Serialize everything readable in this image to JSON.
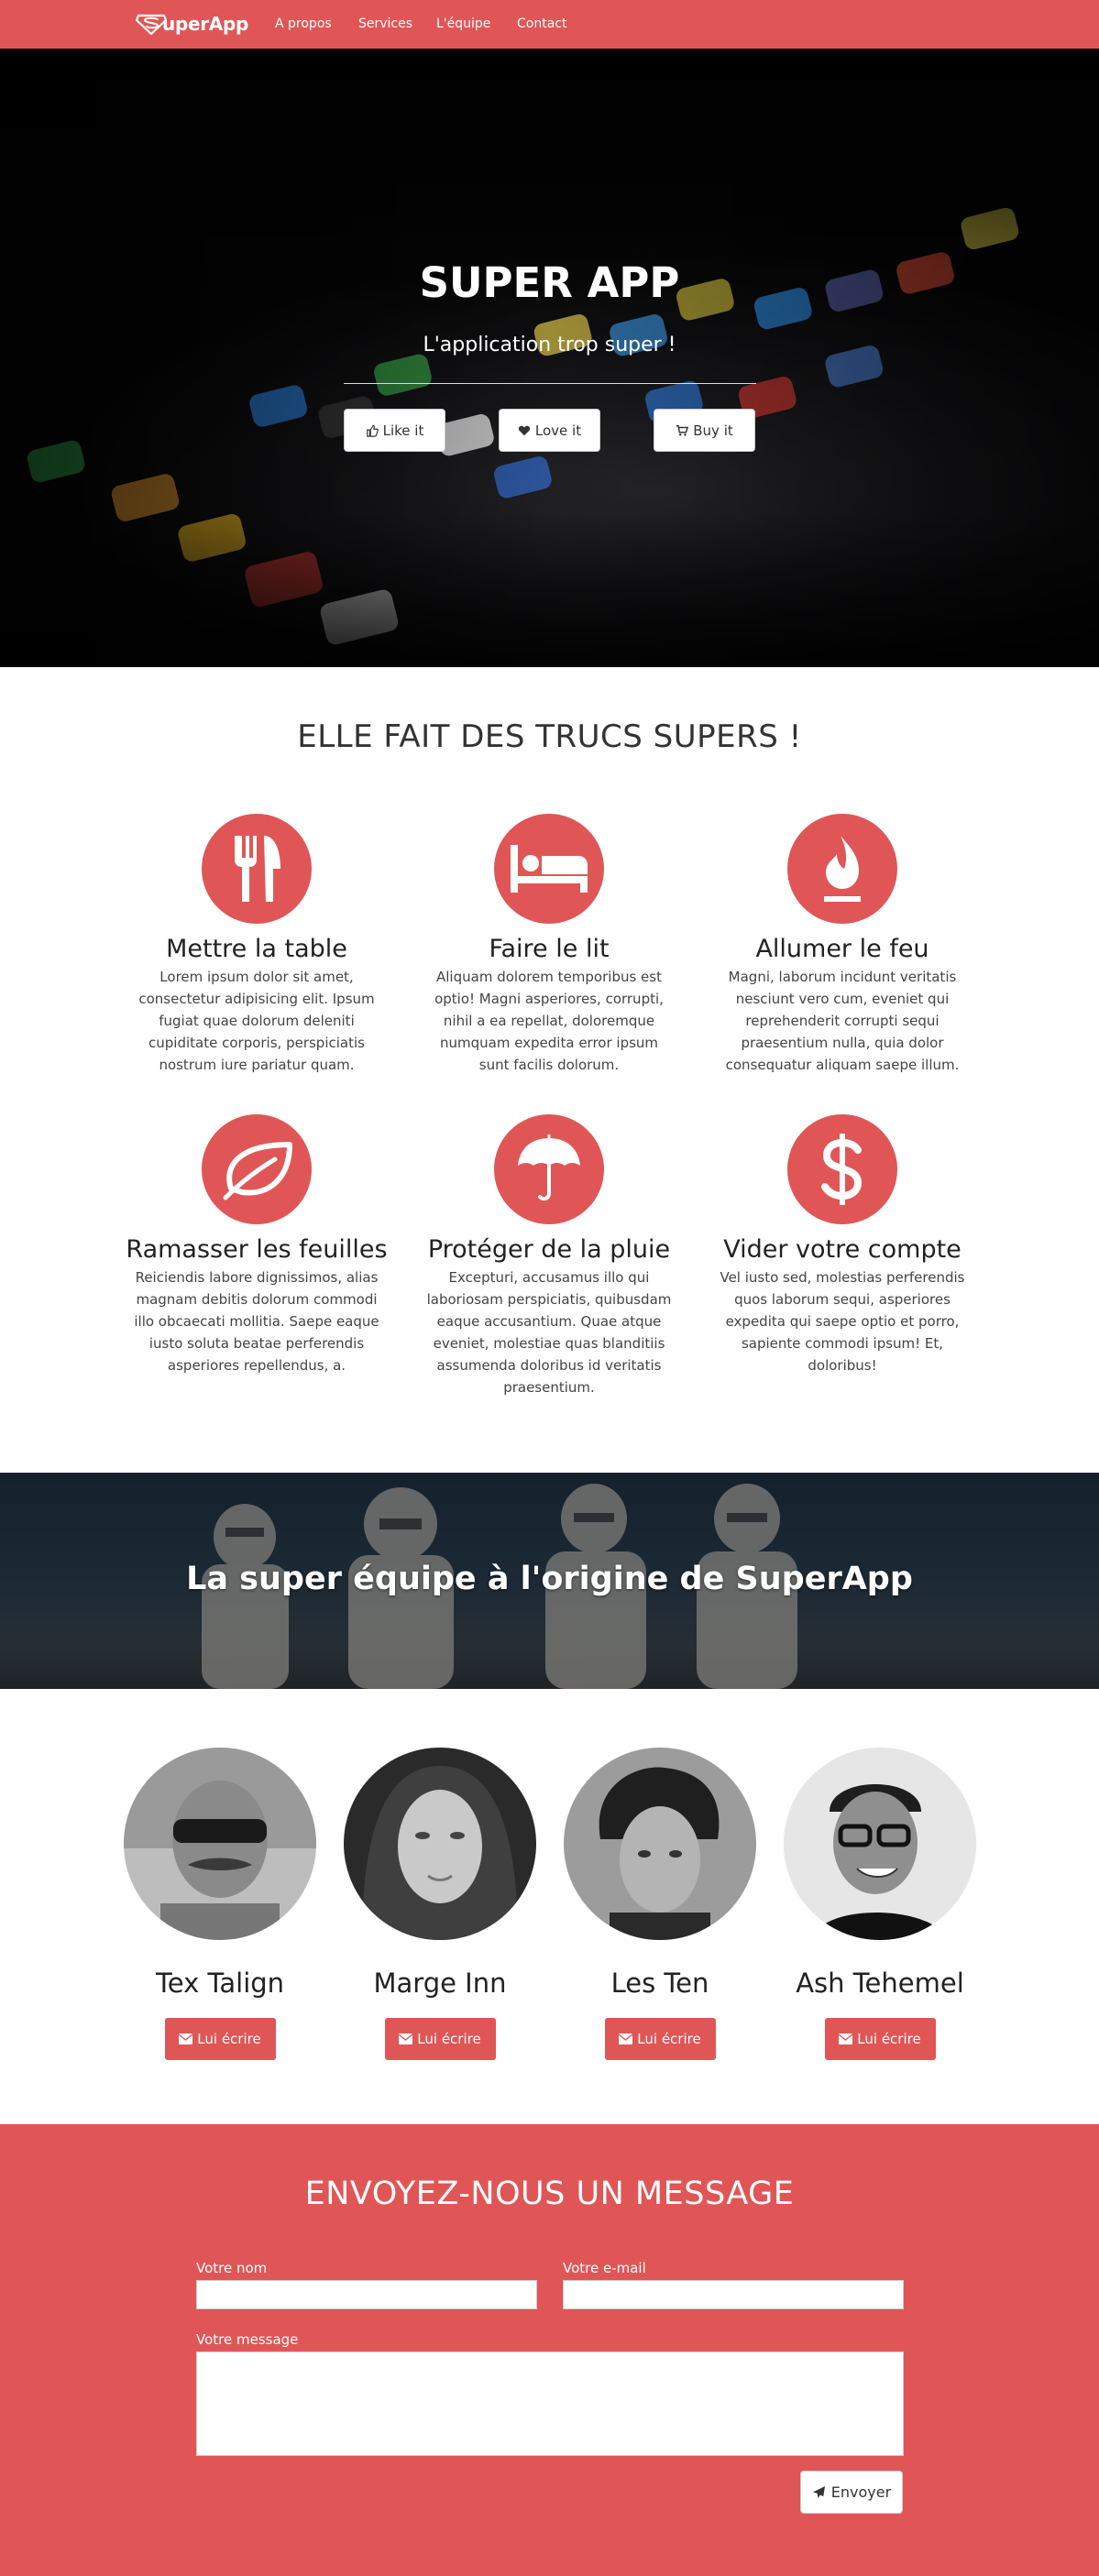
{
  "brand": {
    "name": "uperApp",
    "accent": "#e05656"
  },
  "nav": {
    "items": [
      "A propos",
      "Services",
      "L'équipe",
      "Contact"
    ]
  },
  "hero": {
    "title": "SUPER APP",
    "subtitle": "L'application trop super !",
    "buttons": [
      {
        "label": "Like it",
        "icon": "thumbs-up-icon"
      },
      {
        "label": "Love it",
        "icon": "heart-icon"
      },
      {
        "label": "Buy it",
        "icon": "cart-icon"
      }
    ]
  },
  "features": {
    "title": "ELLE FAIT DES TRUCS SUPERS !",
    "items": [
      {
        "title": "Mettre la table",
        "icon": "cutlery-icon",
        "text": "Lorem ipsum dolor sit amet, consectetur adipisicing elit. Ipsum fugiat quae dolorum deleniti cupiditate corporis, perspiciatis nostrum iure pariatur quam."
      },
      {
        "title": "Faire le lit",
        "icon": "bed-icon",
        "text": "Aliquam dolorem temporibus est optio! Magni asperiores, corrupti, nihil a ea repellat, doloremque numquam expedita error ipsum sunt facilis dolorum."
      },
      {
        "title": "Allumer le feu",
        "icon": "fire-icon",
        "text": "Magni, laborum incidunt veritatis nesciunt vero cum, eveniet qui reprehenderit corrupti sequi praesentium nulla, quia dolor consequatur aliquam saepe illum."
      },
      {
        "title": "Ramasser les feuilles",
        "icon": "leaf-icon",
        "text": "Reiciendis labore dignissimos, alias magnam debitis dolorum commodi illo obcaecati mollitia. Saepe eaque iusto soluta beatae perferendis asperiores repellendus, a."
      },
      {
        "title": "Protéger de la pluie",
        "icon": "umbrella-icon",
        "text": "Excepturi, accusamus illo qui laboriosam perspiciatis, quibusdam eaque accusantium. Quae atque eveniet, molestiae quas blanditiis assumenda doloribus id veritatis praesentium."
      },
      {
        "title": "Vider votre compte",
        "icon": "dollar-icon",
        "text": "Vel iusto sed, molestias perferendis quos laborum sequi, asperiores expedita qui saepe optio et porro, sapiente commodi ipsum! Et, doloribus!"
      }
    ]
  },
  "team": {
    "title": "La super équipe à l'origine de SuperApp",
    "members": [
      {
        "name": "Tex Talign",
        "button": "Lui écrire"
      },
      {
        "name": "Marge Inn",
        "button": "Lui écrire"
      },
      {
        "name": "Les Ten",
        "button": "Lui écrire"
      },
      {
        "name": "Ash Tehemel",
        "button": "Lui écrire"
      }
    ]
  },
  "contact": {
    "title": "ENVOYEZ-NOUS UN MESSAGE",
    "name_label": "Votre nom",
    "email_label": "Votre e-mail",
    "message_label": "Votre message",
    "submit": "Envoyer"
  }
}
